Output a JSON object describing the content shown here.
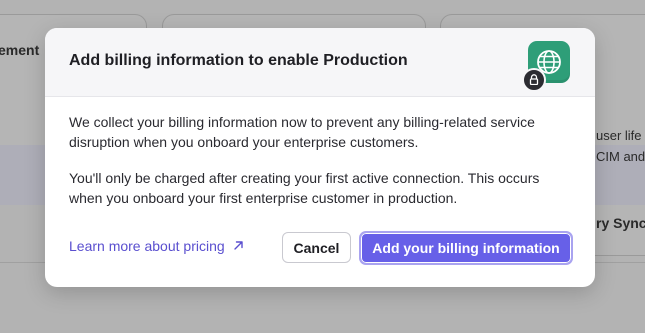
{
  "background": {
    "left_heading": "ement",
    "right_line1": "user life",
    "right_line2": "CIM and",
    "right_action": "ry Sync"
  },
  "modal": {
    "title": "Add billing information to enable Production",
    "paragraph1": "We collect your billing information now to prevent any billing-related service disruption when you onboard your enterprise customers.",
    "paragraph2": "You'll only be charged after creating your first active connection. This occurs when you onboard your first enterprise customer in production.",
    "learn_more_label": "Learn more about pricing",
    "cancel_label": "Cancel",
    "primary_label": "Add your billing information"
  },
  "icons": {
    "header": "globe-icon",
    "badge": "lock-icon",
    "link": "external-arrow-icon"
  },
  "colors": {
    "accent": "#6760e8",
    "link": "#5a4fcf",
    "globe_tile": "#2e9e78",
    "overlay": "#b3b3b3"
  }
}
